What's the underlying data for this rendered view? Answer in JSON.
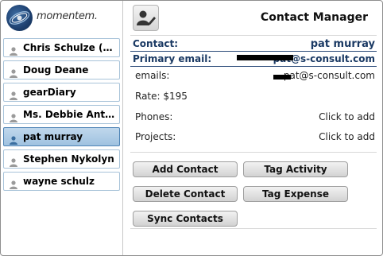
{
  "brand": {
    "logo_text": "momentem."
  },
  "app": {
    "title": "Contact Manager"
  },
  "contacts": [
    {
      "name": "Chris Schulze (C..."
    },
    {
      "name": "Doug Deane"
    },
    {
      "name": "gearDiary"
    },
    {
      "name": "Ms. Debbie Anth..."
    },
    {
      "name": "pat murray",
      "selected": true
    },
    {
      "name": "Stephen Nykolyn"
    },
    {
      "name": "wayne schulz"
    }
  ],
  "detail": {
    "contact_label": "Contact:",
    "contact_value": "pat murray",
    "primary_email_label": "Primary email:",
    "primary_email_value": "pat@s-consult.com",
    "emails_label": "emails:",
    "emails_value": "pat@s-consult.com",
    "rate_label": "Rate: $195",
    "phones_label": "Phones:",
    "phones_value": "Click to add",
    "projects_label": "Projects:",
    "projects_value": "Click to add"
  },
  "buttons": {
    "add_contact": "Add Contact",
    "tag_activity": "Tag Activity",
    "delete_contact": "Delete Contact",
    "tag_expense": "Tag Expense",
    "sync_contacts": "Sync Contacts"
  },
  "colors": {
    "accent": "#1b3a64",
    "selected_row": "#a9c9e6",
    "list_border": "#a8c3d9"
  },
  "icons": {
    "edit": "person-pencil-icon",
    "contact": "person-icon"
  }
}
